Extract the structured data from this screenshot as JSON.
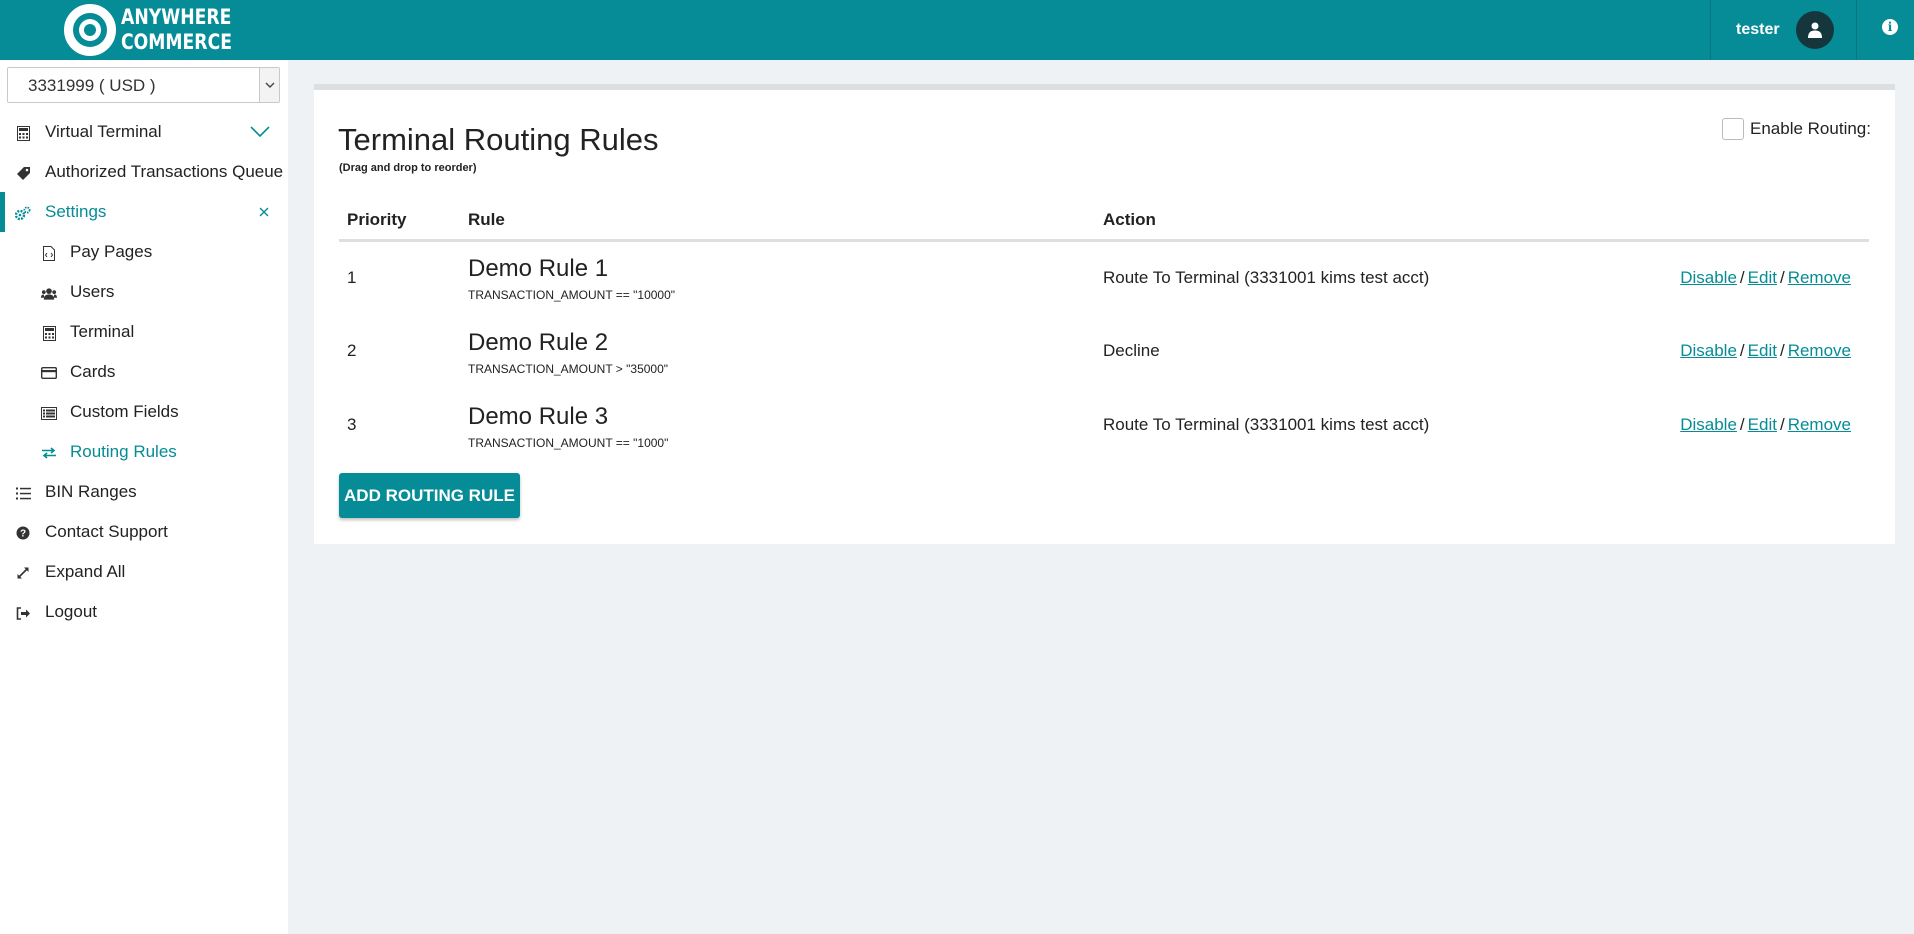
{
  "header": {
    "logo_line1": "ANYWHERE",
    "logo_line2": "COMMERCE",
    "username": "tester"
  },
  "sidebar": {
    "account_select": {
      "value": "3331999 ( USD )"
    },
    "items": [
      {
        "label": "Virtual Terminal",
        "icon": "calculator-icon"
      },
      {
        "label": "Authorized Transactions Queue",
        "icon": "tag-icon"
      },
      {
        "label": "Settings",
        "icon": "gears-icon"
      },
      {
        "label": "Pay Pages",
        "icon": "file-code-icon"
      },
      {
        "label": "Users",
        "icon": "users-icon"
      },
      {
        "label": "Terminal",
        "icon": "calculator-icon"
      },
      {
        "label": "Cards",
        "icon": "credit-card-icon"
      },
      {
        "label": "Custom Fields",
        "icon": "list-alt-icon"
      },
      {
        "label": "Routing Rules",
        "icon": "exchange-icon"
      },
      {
        "label": "BIN Ranges",
        "icon": "list-icon"
      },
      {
        "label": "Contact Support",
        "icon": "question-circle-icon"
      },
      {
        "label": "Expand All",
        "icon": "expand-icon"
      },
      {
        "label": "Logout",
        "icon": "sign-out-icon"
      }
    ]
  },
  "main": {
    "title": "Terminal Routing Rules",
    "subtitle": "(Drag and drop to reorder)",
    "enable_routing_label": "Enable Routing:",
    "enable_routing_checked": false,
    "table": {
      "headers": [
        "Priority",
        "Rule",
        "Action"
      ],
      "rows": [
        {
          "priority": "1",
          "name": "Demo Rule 1",
          "condition": "TRANSACTION_AMOUNT == \"10000\"",
          "action": "Route To Terminal (3331001 kims test acct)"
        },
        {
          "priority": "2",
          "name": "Demo Rule 2",
          "condition": "TRANSACTION_AMOUNT > \"35000\"",
          "action": "Decline"
        },
        {
          "priority": "3",
          "name": "Demo Rule 3",
          "condition": "TRANSACTION_AMOUNT == \"1000\"",
          "action": "Route To Terminal (3331001 kims test acct)"
        }
      ],
      "links": {
        "disable": "Disable",
        "edit": "Edit",
        "remove": "Remove",
        "separator": "/"
      }
    },
    "add_button_label": "ADD ROUTING RULE"
  },
  "colors": {
    "brand": "#058c96",
    "background": "#eff2f5",
    "avatar": "#14363c"
  }
}
